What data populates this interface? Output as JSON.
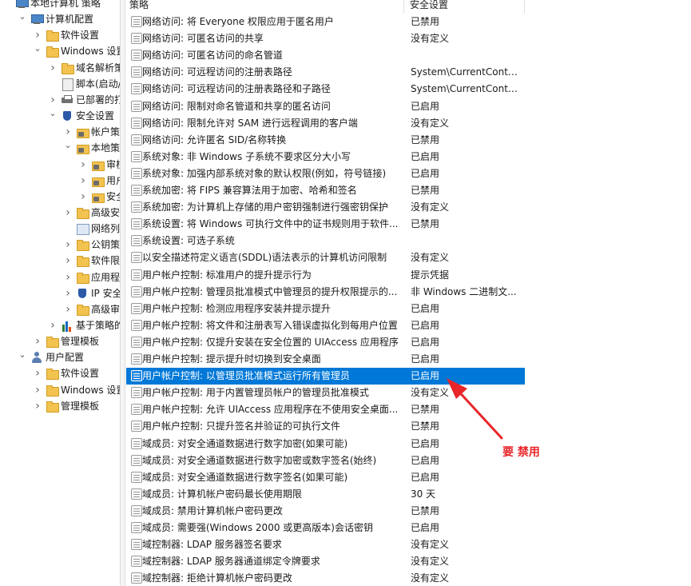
{
  "tree": {
    "items": [
      {
        "label": "本地计算机 策略",
        "icon": "computer-icon",
        "chev": ""
      },
      {
        "label": "计算机配置",
        "icon": "computer-icon",
        "chev": "v"
      },
      {
        "label": "软件设置",
        "icon": "folder-icon",
        "chev": ">"
      },
      {
        "label": "Windows 设置",
        "icon": "folder-icon",
        "chev": "v"
      },
      {
        "label": "域名解析策略",
        "icon": "folder-icon",
        "chev": ">"
      },
      {
        "label": "脚本(启动/关",
        "icon": "document-icon",
        "chev": ""
      },
      {
        "label": "已部署的打印",
        "icon": "printer-icon",
        "chev": ">"
      },
      {
        "label": "安全设置",
        "icon": "shield-icon",
        "chev": "v"
      },
      {
        "label": "帐户策略",
        "icon": "lock-folder-icon",
        "chev": ">"
      },
      {
        "label": "本地策略",
        "icon": "lock-folder-icon",
        "chev": "v"
      },
      {
        "label": "审核策",
        "icon": "lock-folder-icon",
        "chev": ">"
      },
      {
        "label": "用户权",
        "icon": "lock-folder-icon",
        "chev": ">"
      },
      {
        "label": "安全选",
        "icon": "lock-folder-icon",
        "chev": ">"
      },
      {
        "label": "高级安全",
        "icon": "folder-icon",
        "chev": ">"
      },
      {
        "label": "网络列表管",
        "icon": "network-list-icon",
        "chev": ""
      },
      {
        "label": "公钥策略",
        "icon": "folder-icon",
        "chev": ">"
      },
      {
        "label": "软件限制策",
        "icon": "folder-icon",
        "chev": ">"
      },
      {
        "label": "应用程序控",
        "icon": "folder-icon",
        "chev": ">"
      },
      {
        "label": "IP 安全策",
        "icon": "ip-security-icon",
        "chev": ">"
      },
      {
        "label": "高级审核策",
        "icon": "folder-icon",
        "chev": ">"
      },
      {
        "label": "基于策略的 C",
        "icon": "bar-chart-icon",
        "chev": ">"
      },
      {
        "label": "管理模板",
        "icon": "folder-icon",
        "chev": ">"
      },
      {
        "label": "用户配置",
        "icon": "user-icon",
        "chev": "v"
      },
      {
        "label": "软件设置",
        "icon": "folder-icon",
        "chev": ">"
      },
      {
        "label": "Windows 设置",
        "icon": "folder-icon",
        "chev": ">"
      },
      {
        "label": "管理模板",
        "icon": "folder-icon",
        "chev": ">"
      }
    ]
  },
  "list": {
    "header_policy": "策略",
    "header_setting": "安全设置",
    "rows": [
      {
        "policy": "网络访问: 将 Everyone 权限应用于匿名用户",
        "setting": "已禁用"
      },
      {
        "policy": "网络访问: 可匿名访问的共享",
        "setting": "没有定义"
      },
      {
        "policy": "网络访问: 可匿名访问的命名管道",
        "setting": ""
      },
      {
        "policy": "网络访问: 可远程访问的注册表路径",
        "setting": "System\\CurrentContro..."
      },
      {
        "policy": "网络访问: 可远程访问的注册表路径和子路径",
        "setting": "System\\CurrentContro..."
      },
      {
        "policy": "网络访问: 限制对命名管道和共享的匿名访问",
        "setting": "已启用"
      },
      {
        "policy": "网络访问: 限制允许对 SAM 进行远程调用的客户端",
        "setting": "没有定义"
      },
      {
        "policy": "网络访问: 允许匿名 SID/名称转换",
        "setting": "已禁用"
      },
      {
        "policy": "系统对象: 非 Windows 子系统不要求区分大小写",
        "setting": "已启用"
      },
      {
        "policy": "系统对象: 加强内部系统对象的默认权限(例如，符号链接)",
        "setting": "已启用"
      },
      {
        "policy": "系统加密: 将 FIPS 兼容算法用于加密、哈希和签名",
        "setting": "已禁用"
      },
      {
        "policy": "系统加密: 为计算机上存储的用户密钥强制进行强密钥保护",
        "setting": "没有定义"
      },
      {
        "policy": "系统设置: 将 Windows 可执行文件中的证书规则用于软件...",
        "setting": "已禁用"
      },
      {
        "policy": "系统设置: 可选子系统",
        "setting": ""
      },
      {
        "policy": "以安全描述符定义语言(SDDL)语法表示的计算机访问限制",
        "setting": "没有定义"
      },
      {
        "policy": "用户帐户控制: 标准用户的提升提示行为",
        "setting": "提示凭据"
      },
      {
        "policy": "用户帐户控制: 管理员批准模式中管理员的提升权限提示的...",
        "setting": "非 Windows 二进制文..."
      },
      {
        "policy": "用户帐户控制: 检测应用程序安装并提示提升",
        "setting": "已启用"
      },
      {
        "policy": "用户帐户控制: 将文件和注册表写入错误虚拟化到每用户位置",
        "setting": "已启用"
      },
      {
        "policy": "用户帐户控制: 仅提升安装在安全位置的 UIAccess 应用程序",
        "setting": "已启用"
      },
      {
        "policy": "用户帐户控制: 提示提升时切换到安全桌面",
        "setting": "已启用"
      },
      {
        "policy": "用户帐户控制: 以管理员批准模式运行所有管理员",
        "setting": "已启用"
      },
      {
        "policy": "用户帐户控制: 用于内置管理员帐户的管理员批准模式",
        "setting": "没有定义"
      },
      {
        "policy": "用户帐户控制: 允许 UIAccess 应用程序在不使用安全桌面...",
        "setting": "已禁用"
      },
      {
        "policy": "用户帐户控制: 只提升签名并验证的可执行文件",
        "setting": "已禁用"
      },
      {
        "policy": "域成员: 对安全通道数据进行数字加密(如果可能)",
        "setting": "已启用"
      },
      {
        "policy": "域成员: 对安全通道数据进行数字加密或数字签名(始终)",
        "setting": "已启用"
      },
      {
        "policy": "域成员: 对安全通道数据进行数字签名(如果可能)",
        "setting": "已启用"
      },
      {
        "policy": "域成员: 计算机帐户密码最长使用期限",
        "setting": "30 天"
      },
      {
        "policy": "域成员: 禁用计算机帐户密码更改",
        "setting": "已禁用"
      },
      {
        "policy": "域成员: 需要强(Windows 2000 或更高版本)会话密钥",
        "setting": "已启用"
      },
      {
        "policy": "域控制器: LDAP 服务器签名要求",
        "setting": "没有定义"
      },
      {
        "policy": "域控制器: LDAP 服务器通道绑定令牌要求",
        "setting": "没有定义"
      },
      {
        "policy": "域控制器: 拒绝计算机帐户密码更改",
        "setting": "没有定义"
      }
    ]
  },
  "annotation": {
    "text": "要 禁用",
    "color": "#e8262a"
  },
  "colors": {
    "selection": "#0078d7",
    "annotation": "#e8262a"
  }
}
